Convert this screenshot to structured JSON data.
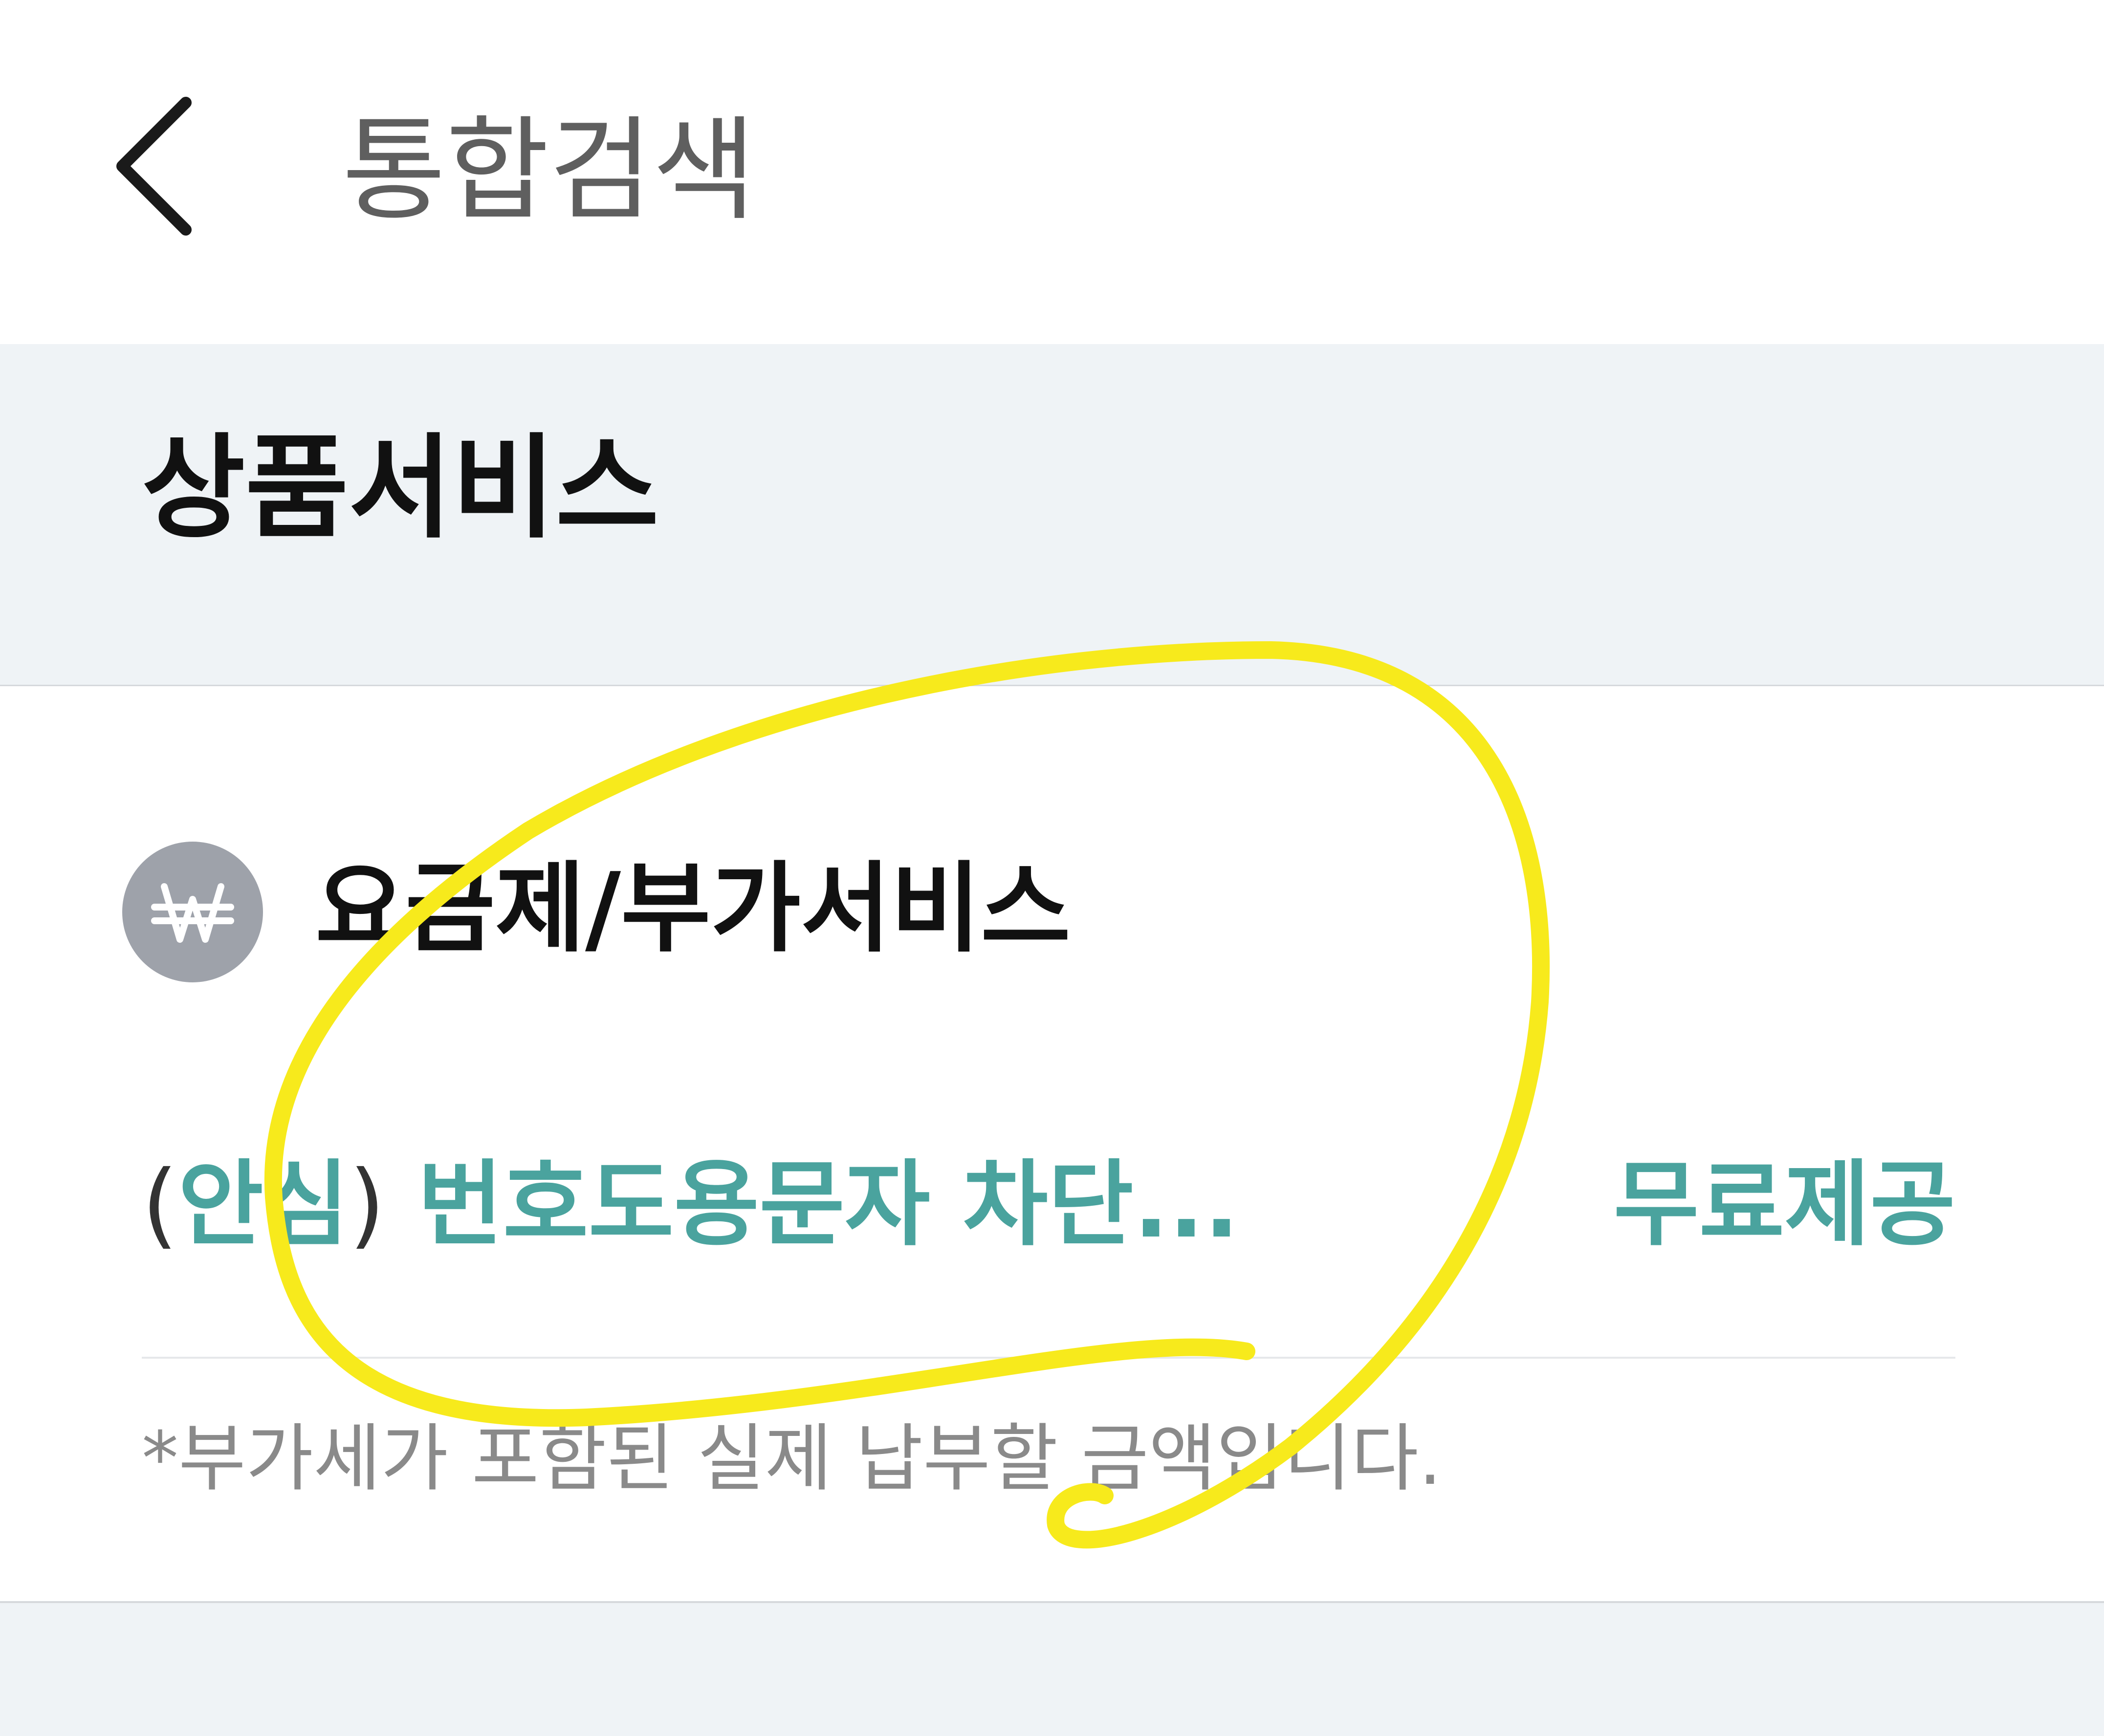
{
  "header": {
    "back_icon": "chevron-left-icon",
    "title": "통합검색"
  },
  "section": {
    "title": "상품서비스"
  },
  "category": {
    "icon": "won-currency-icon",
    "title": "요금제/부가서비스"
  },
  "results": [
    {
      "paren_open": "(",
      "name_prefix": "안심",
      "paren_close": ")",
      "name_rest": " 번호도용문자 차단...",
      "price": "무료제공"
    }
  ],
  "note": "*부가세가 포함된 실제 납부할 금액입니다.",
  "colors": {
    "accent": "#4aa39e",
    "band_background": "#eff3f6",
    "icon_background": "#9ea2aa",
    "highlight_stroke": "#f7ea1c"
  }
}
